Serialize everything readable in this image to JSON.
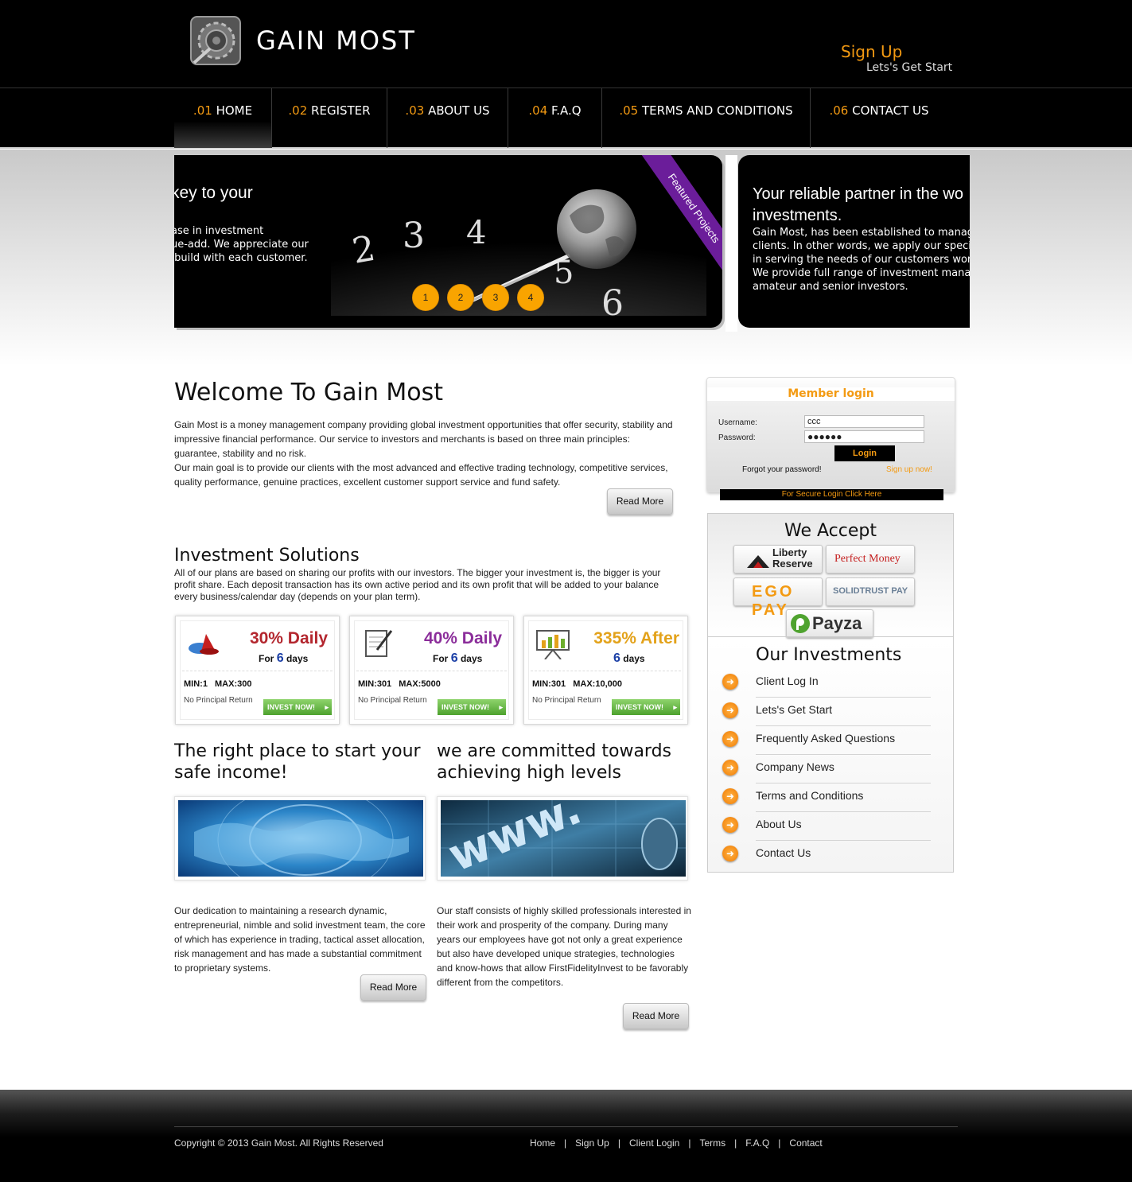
{
  "header": {
    "logo_text": "GAIN MOST",
    "signup_title": "Sign Up",
    "signup_subtitle": "Lets's Get Start"
  },
  "nav": [
    {
      "num": ".01",
      "label": "HOME"
    },
    {
      "num": ".02",
      "label": "REGISTER"
    },
    {
      "num": ".03",
      "label": "ABOUT US"
    },
    {
      "num": ".04",
      "label": "F.A.Q"
    },
    {
      "num": ".05",
      "label": "TERMS AND CONDITIONS"
    },
    {
      "num": ".06",
      "label": "CONTACT US"
    }
  ],
  "slider": {
    "left_heading": "key to your",
    "left_text": "ase in investment\nue-add. We appreciate our\n build with each customer.",
    "ribbon": "Featured Projects",
    "dots": [
      "1",
      "2",
      "3",
      "4"
    ],
    "right_heading": "Your reliable partner in the wo\ninvestments.",
    "right_text": "Gain Most, has been established to manage t\nclients. In other words, we apply our specialis\nin serving the needs of our customers worldw\nWe provide full range of investment manage\namateur and senior investors."
  },
  "welcome": {
    "title": "Welcome To Gain Most",
    "para1": "Gain Most is a money management company providing global investment opportunities that offer security, stability and impressive financial performance. Our service to investors and merchants is based on three main principles: guarantee, stability and no risk.",
    "para2": "Our main goal is to provide our clients with the most advanced and effective trading technology, competitive services, quality performance, genuine practices, excellent customer support service and fund safety.",
    "read_more": "Read More"
  },
  "investment": {
    "title": "Investment Solutions",
    "text": "All of our plans are based on sharing our profits with our investors. The bigger your investment is, the bigger is your profit share. Each deposit transaction has its own active period and its own profit that will be added to your balance every business/calendar day (depends on your plan term).",
    "plans": [
      {
        "rate": "30% Daily",
        "for": "For",
        "days_num": "6",
        "days": "days",
        "minmax": "MIN:1 MAX:300",
        "principal": "No Principal Return",
        "button": "INVEST NOW!",
        "color": "#b3262e"
      },
      {
        "rate": "40% Daily",
        "for": "For",
        "days_num": "6",
        "days": "days",
        "minmax": "MIN:301 MAX:5000",
        "principal": "No Principal Return",
        "button": "INVEST NOW!",
        "color": "#8b2d9a"
      },
      {
        "rate": "335% After",
        "for": "",
        "days_num": "6",
        "days": "days",
        "minmax": "MIN:301 MAX:10,000",
        "principal": "No Principal Return",
        "button": "INVEST NOW!",
        "color": "#e3a21a"
      }
    ]
  },
  "columns": [
    {
      "title": "The right place to start your safe income!",
      "text": "Our dedication to maintaining a research dynamic, entrepreneurial, nimble and solid investment team, the core of which has experience in trading, tactical asset allocation, risk management and has made a substantial commitment to proprietary systems.",
      "read_more": "Read More"
    },
    {
      "title": "we are committed towards achieving high levels",
      "text": "Our staff consists of highly skilled professionals interested in their work and prosperity of the company. During many years our employees have got not only a great experience but also have developed unique strategies, technologies and know-hows that allow FirstFidelityInvest to be favorably different from the competitors.",
      "read_more": "Read More"
    }
  ],
  "login": {
    "title": "Member login",
    "username_label": "Username:",
    "username_value": "ccc",
    "password_label": "Password:",
    "password_value": "●●●●●●",
    "button": "Login",
    "forgot": "Forgot your password!",
    "signup": "Sign up now!",
    "secure": "For Secure Login Click Here"
  },
  "accept": {
    "title": "We Accept",
    "logos": [
      "Liberty Reserve",
      "Perfect Money",
      "EGO PAY",
      "SOLIDTRUST PAY",
      "Payza"
    ]
  },
  "our_investments": {
    "title": "Our Investments",
    "links": [
      "Client Log In",
      "Lets's Get Start",
      "Frequently Asked Questions",
      "Company News",
      "Terms and Conditions",
      "About Us",
      "Contact Us"
    ]
  },
  "footer": {
    "copyright": "Copyright © 2013 Gain Most. All Rights Reserved",
    "links": [
      "Home",
      "Sign Up",
      "Client Login",
      "Terms",
      "F.A.Q",
      "Contact"
    ]
  },
  "colors": {
    "accent": "#f39a12",
    "ribbon": "#6b1d9a",
    "dot": "#f9a400"
  }
}
